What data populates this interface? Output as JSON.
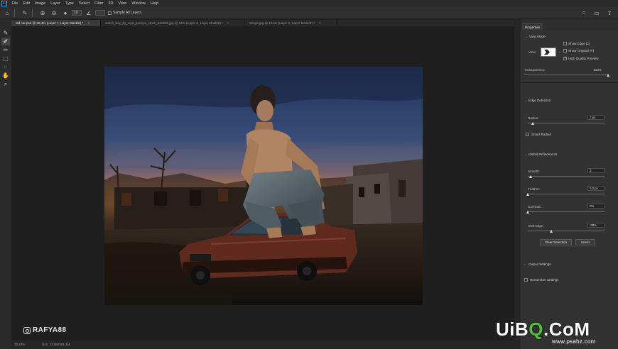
{
  "menubar": {
    "logo": "Ps",
    "items": [
      "File",
      "Edit",
      "Image",
      "Layer",
      "Type",
      "Select",
      "Filter",
      "3D",
      "View",
      "Window",
      "Help"
    ]
  },
  "options": {
    "brush_size": "10",
    "sample_all_layers": "Sample All Layers"
  },
  "tabs": [
    {
      "label": "old car.psd @ 39,4% (Layer 7, Layer Mask/8) *"
    },
    {
      "label": "watch_boy_by_aiya_poenya_stock_d2obd2.jpg @ 21% (Layer 0, Layer Mask/8) *"
    },
    {
      "label": "Wings.jpg @ 151% (Layer 0, Layer Mask/8) *"
    }
  ],
  "status": {
    "zoom": "39,43%",
    "doc": "Doc: 13,9M/381,3M"
  },
  "watermark": {
    "handle": "RAFYA88",
    "site_a": "UiB",
    "site_b": "Q",
    "site_c": ".CoM",
    "site_sub": "www.psahz.com"
  },
  "properties": {
    "tab": "Properties",
    "view_mode": "View Mode",
    "view": "View:",
    "show_edge": "Show Edge (J)",
    "show_original": "Show Original (P)",
    "high_quality": "High Quality Preview",
    "transparency_label": "Transparency:",
    "transparency_value": "100%",
    "transparency": 1.0,
    "edge_detection": "Edge Detection",
    "radius_label": "Radius:",
    "radius_value": "1 px",
    "smart_radius": "Smart Radius",
    "global_refinements": "Global Refinements",
    "smooth_label": "Smooth:",
    "smooth_value": "3",
    "feather_label": "Feather:",
    "feather_value": "0,0 px",
    "contrast_label": "Contrast:",
    "contrast_value": "0%",
    "shift_edge_label": "Shift Edge:",
    "shift_edge_value": "-38%",
    "clear_selection": "Clear Selection",
    "invert": "Invert",
    "output_settings": "Output Settings",
    "remember_settings": "Remember Settings"
  },
  "colors": {
    "ps_blue": "#31a8ff",
    "ui_dark": "#323232"
  },
  "icons": [
    "home-icon",
    "brush-icon",
    "search-icon",
    "workspace-icon",
    "share-icon"
  ]
}
